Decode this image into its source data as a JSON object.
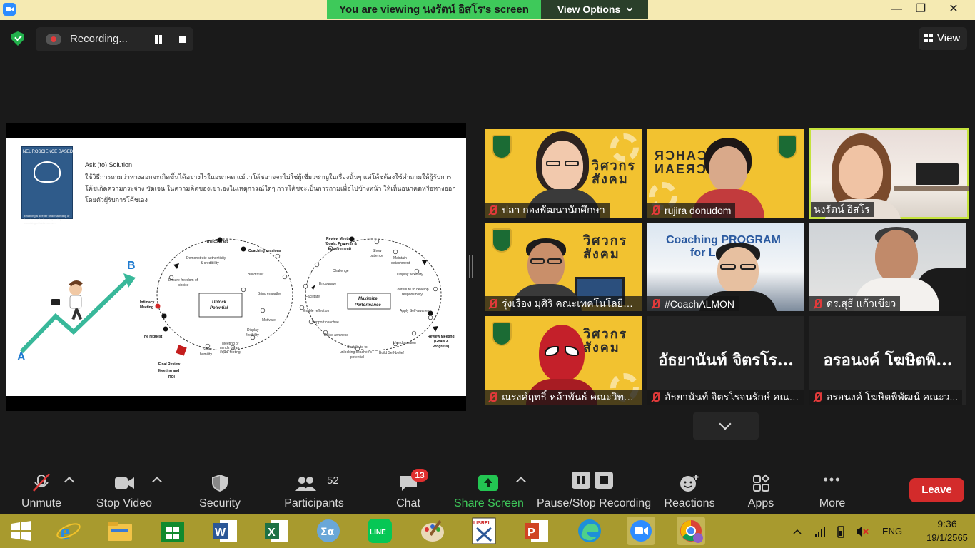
{
  "window": {
    "viewing_banner": "You are viewing นงรัตน์ อิสโร's screen",
    "view_options": "View Options",
    "min_glyph": "—",
    "max_glyph": "❐",
    "close_glyph": "✕"
  },
  "topbar": {
    "recording_label": "Recording...",
    "view_label": "View"
  },
  "slide": {
    "book_title": "NEUROSCIENCE BASED",
    "book_sub": "Enabling a deeper understanding of how to coach, thus improving coaching effectiveness...",
    "heading": "Ask (to) Solution",
    "body": "ใช้วิธีการถามว่าทางออกจะเกิดขึ้นได้อย่างไรในอนาคต แม้ว่าโค้ชอาจจะไม่ใช่ผู้เชี่ยวชาญในเรื่องนั้นๆ แต่โค้ชต้องใช้คำถามให้ผู้รับการโค้ชเกิดความกระจ่าง ชัดเจน ในความคิดของเขาเองในเหตุการณ์ใดๆ การโค้ชจะเป็นการถามเพื่อไปข้างหน้า ให้เห็นอนาคตหรือทางออกโดยตัวผู้รับการโค้ชเอง",
    "label_a": "A",
    "label_b": "B",
    "unlock": [
      "Unlock",
      "Potential"
    ],
    "maximize": [
      "Maximize",
      "Performance"
    ],
    "left_loop": {
      "the_contract": "The contract",
      "coaching_sessions": "Coaching sessions",
      "demonstrate": [
        "Demonstrate authenticity",
        "& credibility"
      ],
      "build_trust": "Build trust",
      "ensure": [
        "Ensure freedom of",
        "choice"
      ],
      "bring_empathy": "Bring empathy",
      "intimacy": [
        "Intimacy",
        "Meeting"
      ],
      "motivate": "Motivate",
      "display_flex": [
        "Display",
        "flexibility"
      ],
      "meeting_minds": [
        "Meeting of",
        "minds on an",
        "equal footing"
      ],
      "show_humility": [
        "Show",
        "humility"
      ],
      "the_request": "The request",
      "final_review": [
        "Final Review",
        "Meeting and",
        "ROI"
      ]
    },
    "right_loop": {
      "review_top": [
        "Review Meeting",
        "(Goals, Progress &",
        "achievement)"
      ],
      "show_patience": [
        "Show",
        "patience"
      ],
      "maintain": [
        "Maintain",
        "detachment"
      ],
      "challenge": "Challenge",
      "display_flex2": "Display flexibility",
      "encourage": "Encourage",
      "contribute_dev": [
        "Contribute to develop",
        "responsibility"
      ],
      "facilitate": "Facilitate",
      "enable_reflection": "Enable reflection",
      "apply_self": "Apply Self-awaness",
      "support_coachee": "Support coachee",
      "use_discretion": "Use discretion",
      "raise_awareness": "Raise awaness",
      "review_right": [
        "Review Meeting",
        "(Goals &",
        "Progress)"
      ],
      "contribute_unlock": [
        "Contribute to",
        "unlocking coachee's",
        "potential"
      ],
      "build_belief": "Build Self-belief"
    }
  },
  "tiles": [
    {
      "name": "ปลา กองพัฒนานักศึกษา"
    },
    {
      "name": "rujira donudom",
      "brand": "ЯƆНAƆ ИАЕЯƆ"
    },
    {
      "name": "นงรัตน์ อิสโร"
    },
    {
      "name": "รุ่งเรือง มุศิริ คณะเทคโนโลยีอุต..."
    },
    {
      "name": "#CoachALMON",
      "coach_text": "Coaching PROGRAM",
      "coach_text2": "for L"
    },
    {
      "name": "ดร.สุธี แก้วเขียว"
    },
    {
      "name": "ณรงค์ฤทธิ์ หล้าพันธ์ คณะวิทย..."
    },
    {
      "name": "อัธยานันท์ จิตรโรจนรักษ์ คณะ...",
      "big": "อัธยานันท์ จิตรโร..."
    },
    {
      "name": "อรอนงค์ โฆษิตพิพัฒน์ คณะว...",
      "big": "อรอนงค์ โฆษิตพิ..."
    }
  ],
  "tile_brand": "วิศวกร สังคม",
  "toolbar": {
    "unmute": "Unmute",
    "stop_video": "Stop Video",
    "security": "Security",
    "participants": "Participants",
    "participants_count": "52",
    "chat": "Chat",
    "chat_badge": "13",
    "share_screen": "Share Screen",
    "pause_stop": "Pause/Stop Recording",
    "reactions": "Reactions",
    "apps": "Apps",
    "more": "More",
    "more_glyph": "•••",
    "leave": "Leave"
  },
  "taskbar": {
    "lang": "ENG",
    "time": "9:36",
    "date": "19/1/2565",
    "word_glyph": "W",
    "excel_glyph": "X",
    "ppt_glyph": "P",
    "line_glyph": "LINE",
    "lisrel_glyph": "LISREL"
  },
  "colors": {
    "accent_green": "#3ec95a",
    "leave_red": "#d32b2b",
    "speaking_outline": "#c5e33c",
    "tile_yellow": "#f2c230"
  }
}
